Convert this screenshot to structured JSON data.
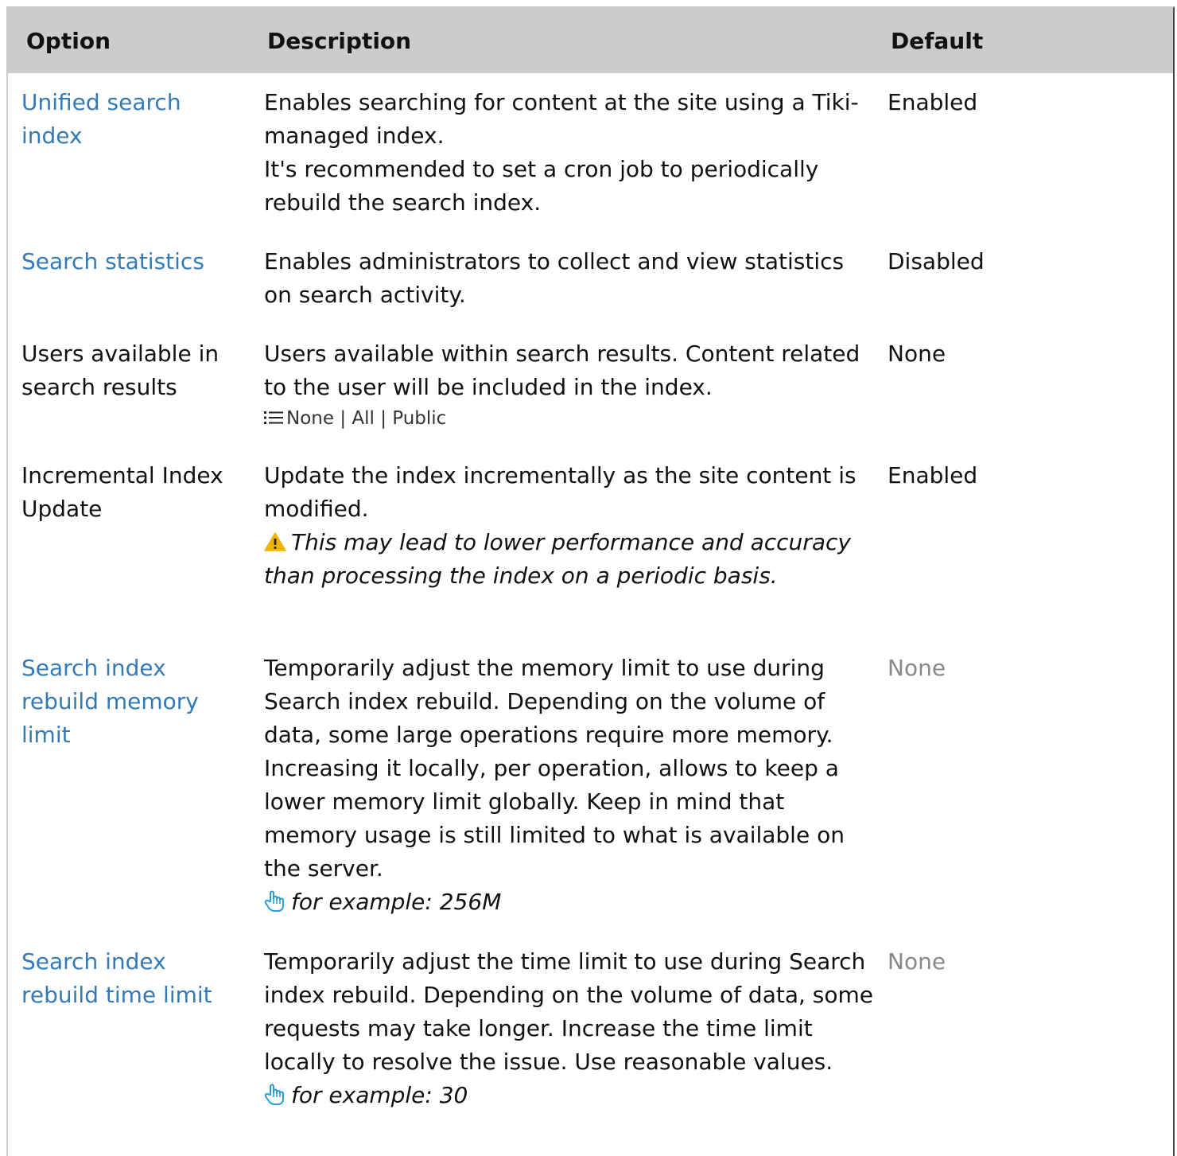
{
  "table": {
    "headers": {
      "option": "Option",
      "description": "Description",
      "default": "Default"
    },
    "rows": [
      {
        "option": "Unified search index",
        "option_is_link": true,
        "description_lines": [
          "Enables searching for content at the site using a Tiki-managed index.",
          "It's recommended to set a cron job to periodically rebuild the search index."
        ],
        "default": "Enabled"
      },
      {
        "option": "Search statistics",
        "option_is_link": true,
        "description_lines": [
          "Enables administrators to collect and view statistics on search activity."
        ],
        "default": "Disabled"
      },
      {
        "option": "Users available in search results",
        "option_is_link": false,
        "description_lines": [
          "Users available within search results. Content related to the user will be included in the index."
        ],
        "choices": "None | All | Public",
        "default": "None"
      },
      {
        "option": "Incremental Index Update",
        "option_is_link": false,
        "description_lines": [
          "Update the index incrementally as the site content is modified."
        ],
        "warning": "This may lead to lower performance and accuracy than processing the index on a periodic basis.",
        "default": "Enabled"
      },
      {
        "option": "Search index rebuild memory limit",
        "option_is_link": true,
        "description_lines": [
          "Temporarily adjust the memory limit to use during Search index rebuild. Depending on the volume of data, some large operations require more memory. Increasing it locally, per operation, allows to keep a lower memory limit globally. Keep in mind that memory usage is still limited to what is available on the server."
        ],
        "example": "for example: 256M",
        "default": "None",
        "default_muted": true
      },
      {
        "option": "Search index rebuild time limit",
        "option_is_link": true,
        "description_lines": [
          "Temporarily adjust the time limit to use during Search index rebuild. Depending on the volume of data, some requests may take longer. Increase the time limit locally to resolve the issue. Use reasonable values."
        ],
        "example": "for example: 30",
        "default": "None",
        "default_muted": true
      }
    ]
  },
  "colors": {
    "header_bg": "#cccccc",
    "link": "#337ab7",
    "muted": "#888888",
    "warning": "#f0b400",
    "hint_icon": "#2a9fd6"
  },
  "icons": {
    "choices": "list-icon",
    "warning": "warning-triangle-icon",
    "example": "pointing-hand-icon"
  }
}
